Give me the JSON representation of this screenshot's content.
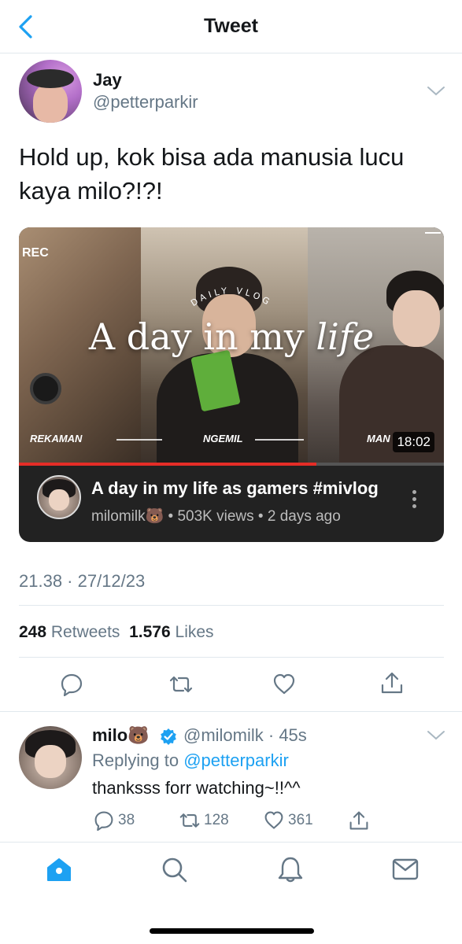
{
  "nav": {
    "title": "Tweet",
    "back_icon": "chevron-left-icon"
  },
  "tweet": {
    "author_name": "Jay",
    "author_handle": "@petterparkir",
    "text_line1": "Hold up, kok bisa ada manusia lucu",
    "text_line2": "kaya milo?!?!",
    "timestamp": "21.38 · 27/12/23",
    "retweets_count": "248",
    "retweets_label": "Retweets",
    "likes_count": "1.576",
    "likes_label": "Likes"
  },
  "video_card": {
    "rec": "REC",
    "daily_vlog": "DAILY VLOG",
    "overlay_title_main": "A day in my",
    "overlay_title_italic": "life",
    "segment_1": "REKAMAN",
    "segment_2": "NGEMIL",
    "segment_3": "MAN",
    "duration": "18:02",
    "progress_fraction": 0.7,
    "title": "A day in my life as gamers #mivlog",
    "channel": "milomilk🐻",
    "meta": " • 503K views • 2 days ago"
  },
  "reply": {
    "name": "milo🐻",
    "handle": "@milomilk · 45s",
    "replying_prefix": "Replying to ",
    "replying_to": "@petterparkir",
    "text": "thanksss forr watching~!!^^",
    "replies": "38",
    "retweets": "128",
    "likes": "361"
  },
  "colors": {
    "accent": "#1da1f2",
    "muted": "#657786",
    "divider": "#e1e8ed",
    "youtube_red": "#e52d27"
  }
}
